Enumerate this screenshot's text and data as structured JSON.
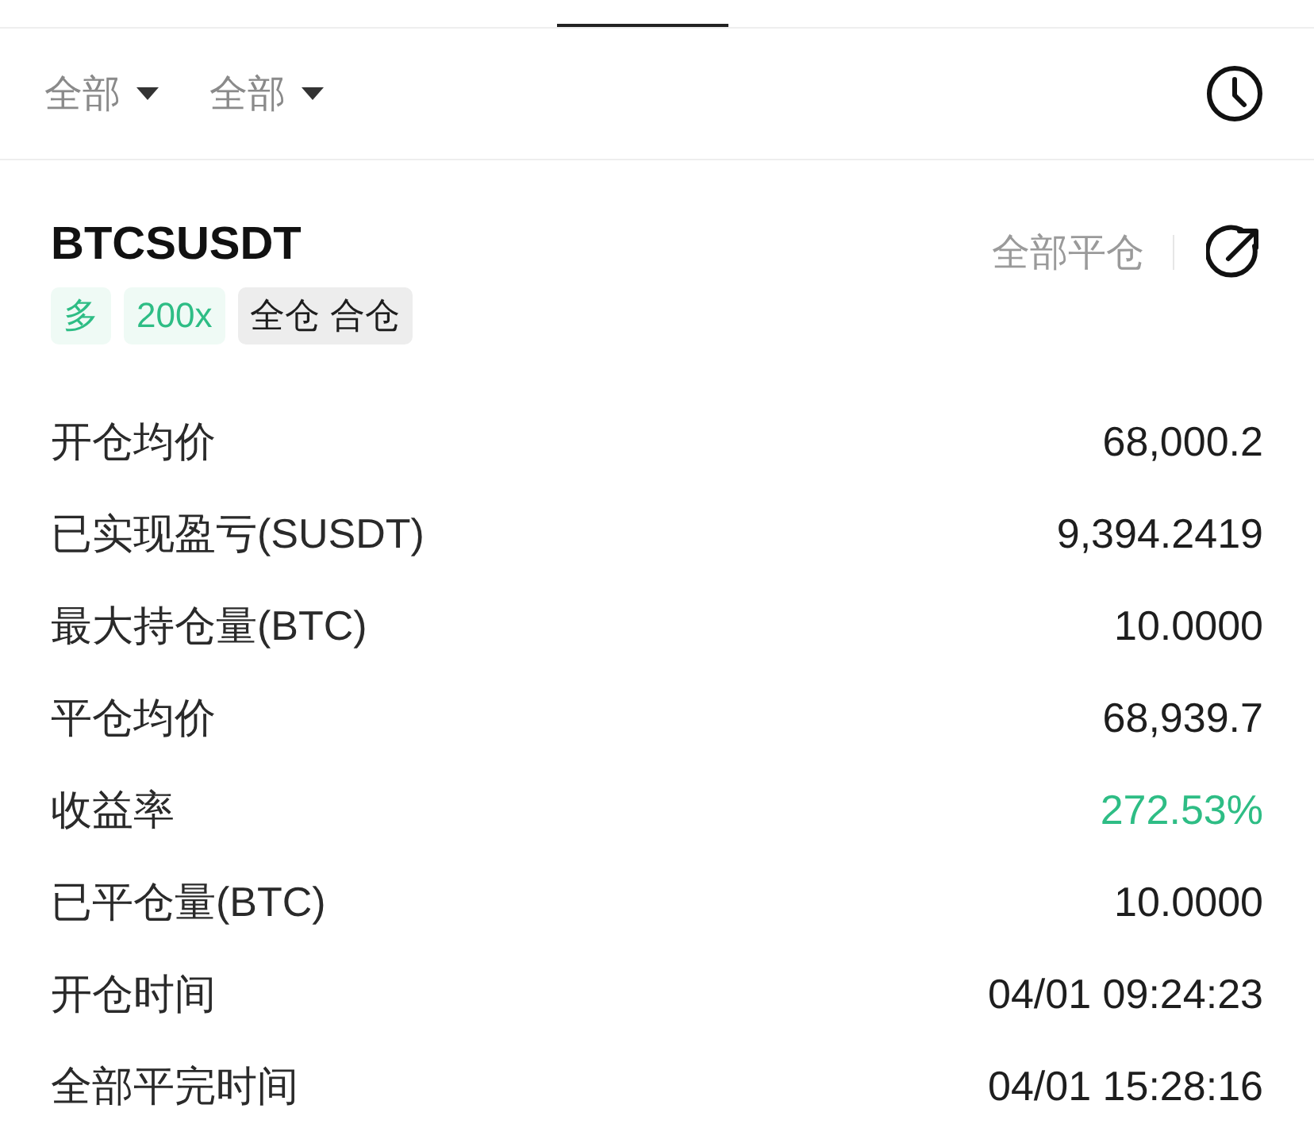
{
  "filters": [
    {
      "label": "全部"
    },
    {
      "label": "全部"
    }
  ],
  "position": {
    "symbol": "BTCSUSDT",
    "close_all": "全部平仓",
    "tags": [
      {
        "label": "多",
        "color": "#2ebd85"
      },
      {
        "label": "200x",
        "color": "#2ebd85"
      },
      {
        "label": "全仓 合仓",
        "color": "#1e1e1e"
      }
    ],
    "rows": [
      {
        "label": "开仓均价",
        "value": "68,000.2",
        "color": "#1e1e1e"
      },
      {
        "label": "已实现盈亏(SUSDT)",
        "value": "9,394.2419",
        "color": "#1e1e1e"
      },
      {
        "label": "最大持仓量(BTC)",
        "value": "10.0000",
        "color": "#1e1e1e"
      },
      {
        "label": "平仓均价",
        "value": "68,939.7",
        "color": "#1e1e1e"
      },
      {
        "label": "收益率",
        "value": "272.53%",
        "color": "#2ebd85"
      },
      {
        "label": "已平仓量(BTC)",
        "value": "10.0000",
        "color": "#1e1e1e"
      },
      {
        "label": "开仓时间",
        "value": "04/01 09:24:23",
        "color": "#1e1e1e"
      },
      {
        "label": "全部平完时间",
        "value": "04/01 15:28:16",
        "color": "#1e1e1e"
      }
    ]
  }
}
